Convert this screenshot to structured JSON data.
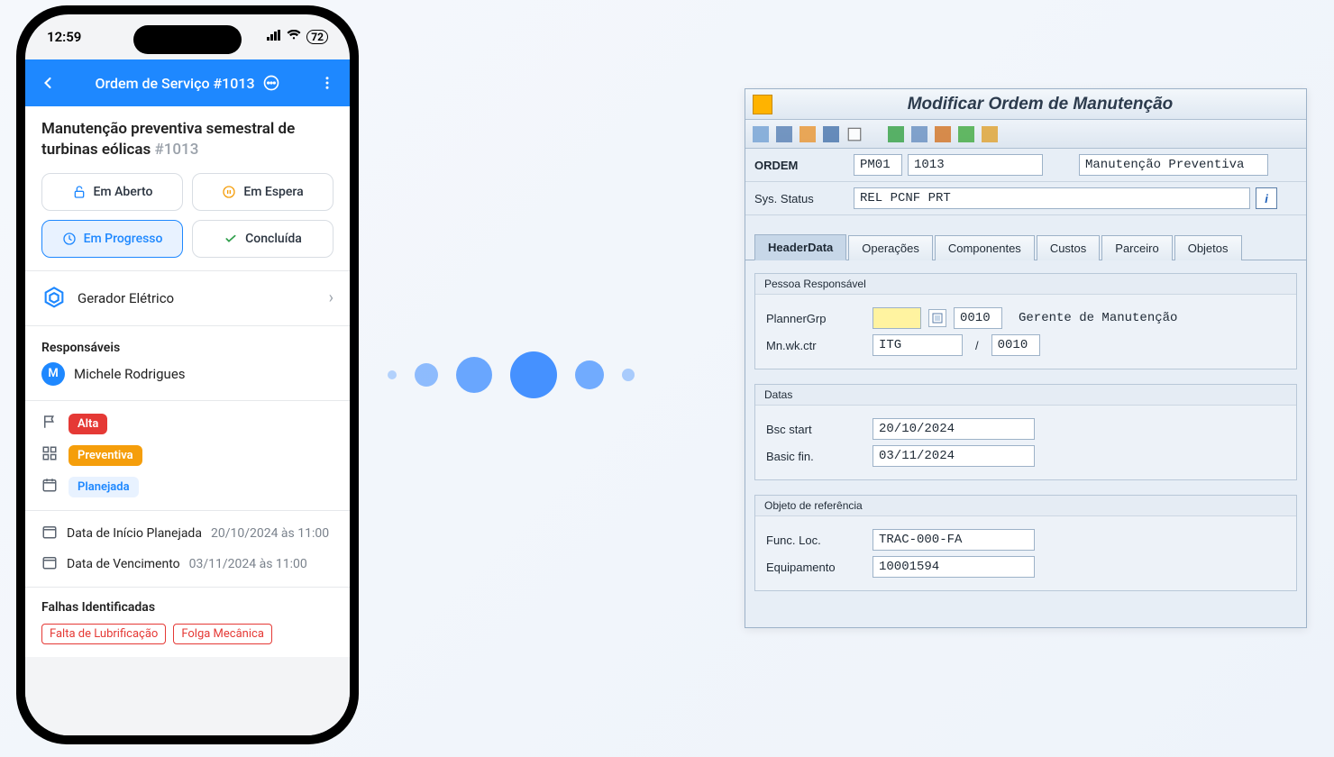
{
  "phone": {
    "statusbar": {
      "time": "12:59",
      "battery": "72"
    },
    "header": {
      "title": "Ordem de Serviço #1013"
    },
    "workorder": {
      "title": "Manutenção preventiva semestral de turbinas eólicas",
      "id": "#1013"
    },
    "status_buttons": {
      "open": "Em Aberto",
      "waiting": "Em Espera",
      "progress": "Em Progresso",
      "done": "Concluída"
    },
    "asset": {
      "name": "Gerador Elétrico"
    },
    "responsibles": {
      "label": "Responsáveis",
      "person": {
        "initial": "M",
        "name": "Michele Rodrigues"
      }
    },
    "tags": {
      "priority": "Alta",
      "type": "Preventiva",
      "state": "Planejada"
    },
    "dates": {
      "start_label": "Data de Início Planejada",
      "start_value": "20/10/2024 às 11:00",
      "due_label": "Data de Vencimento",
      "due_value": "03/11/2024 às 11:00"
    },
    "failures": {
      "label": "Falhas Identificadas",
      "items": [
        "Falta de Lubrificação",
        "Folga Mecânica"
      ]
    }
  },
  "sap": {
    "title": "Modificar Ordem de Manutenção",
    "order": {
      "label": "ORDEM",
      "type": "PM01",
      "number": "1013",
      "desc": "Manutenção Preventiva"
    },
    "status": {
      "label": "Sys. Status",
      "value": "REL PCNF PRT"
    },
    "tabs": [
      "HeaderData",
      "Operações",
      "Componentes",
      "Custos",
      "Parceiro",
      "Objetos"
    ],
    "sections": {
      "resp": {
        "legend": "Pessoa Responsável",
        "planner_label": "PlannerGrp",
        "planner_code": "0010",
        "planner_desc": "Gerente de Manutenção",
        "wkctr_label": "Mn.wk.ctr",
        "wkctr_a": "ITG",
        "wkctr_b": "0010"
      },
      "dates": {
        "legend": "Datas",
        "start_label": "Bsc start",
        "start_value": "20/10/2024",
        "fin_label": "Basic fin.",
        "fin_value": "03/11/2024"
      },
      "ref": {
        "legend": "Objeto de referência",
        "funcloc_label": "Func. Loc.",
        "funcloc_value": "TRAC-000-FA",
        "equip_label": "Equipamento",
        "equip_value": "10001594"
      }
    }
  }
}
